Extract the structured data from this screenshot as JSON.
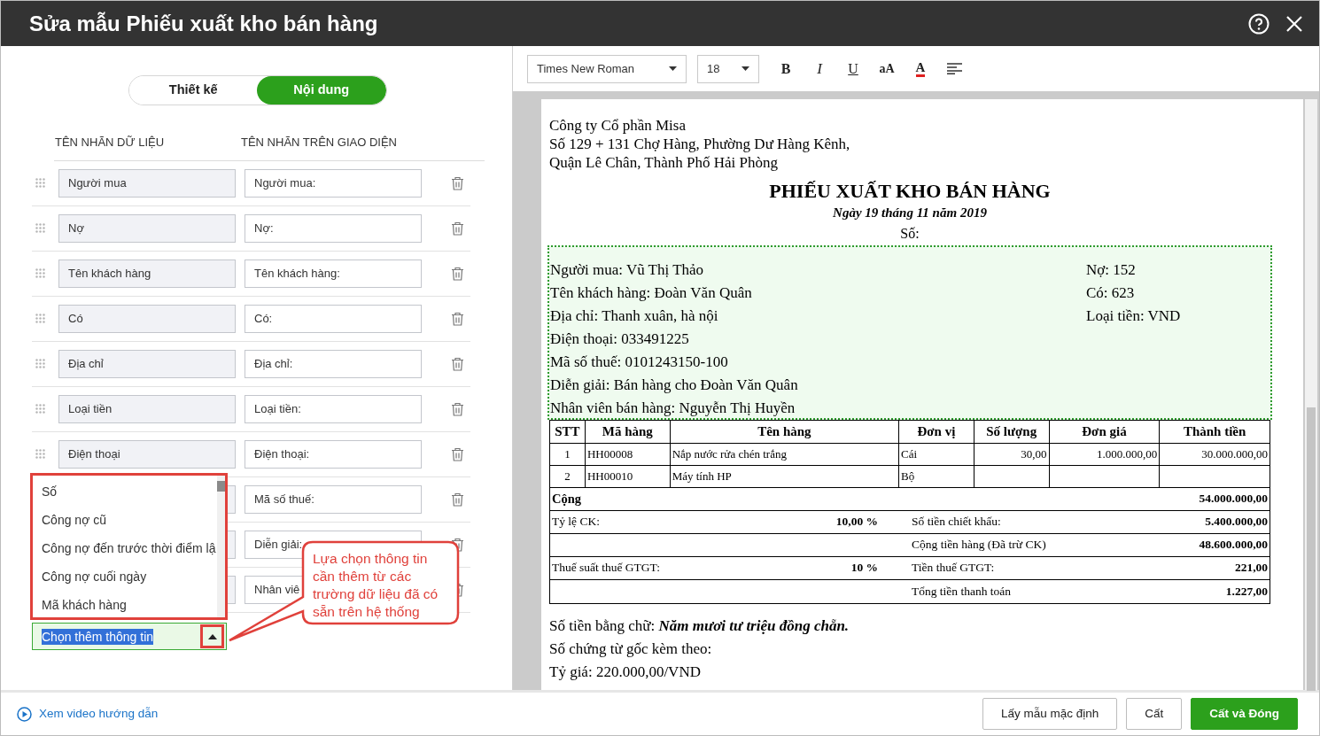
{
  "window": {
    "title": "Sửa mẫu Phiếu xuất kho bán hàng"
  },
  "tabs": [
    {
      "label": "Thiết kế",
      "selected": false
    },
    {
      "label": "Nội dung",
      "selected": true
    }
  ],
  "columns": [
    "TÊN NHÃN DỮ LIỆU",
    "TÊN NHÃN TRÊN GIAO DIỆN"
  ],
  "fields": [
    {
      "data_label": "Người mua",
      "display_label": "Người mua:"
    },
    {
      "data_label": "Nợ",
      "display_label": "Nợ:"
    },
    {
      "data_label": "Tên khách hàng",
      "display_label": "Tên khách hàng:"
    },
    {
      "data_label": "Có",
      "display_label": "Có:"
    },
    {
      "data_label": "Địa chỉ",
      "display_label": "Địa chỉ:"
    },
    {
      "data_label": "Loại tiền",
      "display_label": "Loại tiền:"
    },
    {
      "data_label": "Điện thoại",
      "display_label": "Điện thoại:"
    },
    {
      "display_label": "Mã số thuế:"
    },
    {
      "display_label": "Diễn giải:"
    },
    {
      "display_label": "Nhân viê"
    }
  ],
  "add_field": {
    "value": "Chọn thêm thông tin",
    "expanded": true,
    "options": [
      "Số",
      "Công nợ cũ",
      "Công nợ đến trước thời điểm lậ",
      "Công nợ cuối ngày",
      "Mã khách hàng"
    ]
  },
  "callout": {
    "lines": [
      "Lựa chọn thông tin",
      "cần thêm từ các",
      "trường dữ liệu đã có",
      "sẵn trên hệ thống"
    ]
  },
  "toolbar": {
    "font": "Times New Roman",
    "size": "18",
    "buttons": [
      {
        "kind": "bold",
        "label": "B"
      },
      {
        "kind": "italic",
        "label": "I"
      },
      {
        "kind": "underline",
        "label": "U"
      },
      {
        "kind": "case",
        "label": "aA"
      },
      {
        "kind": "color",
        "label": "A"
      },
      {
        "kind": "align"
      }
    ]
  },
  "document": {
    "company_lines": [
      "Công ty Cổ phần Misa",
      "Số 129 + 131 Chợ Hàng, Phường Dư Hàng Kênh,",
      "Quận Lê Chân, Thành Phố Hải Phòng"
    ],
    "title": "PHIẾU XUẤT KHO BÁN HÀNG",
    "date": "Ngày 19 tháng 11 năm 2019",
    "number_label": "Số:",
    "info_left": [
      "Người mua: Vũ Thị Thảo",
      "Tên khách hàng: Đoàn Văn Quân",
      "Địa chỉ: Thanh xuân, hà nội",
      "Điện thoại: 033491225",
      "Mã số thuế: 0101243150-100",
      "Diễn giải: Bán hàng cho Đoàn Văn Quân",
      "Nhân viên bán hàng: Nguyễn Thị Huyền"
    ],
    "info_right": [
      "Nợ: 152",
      "Có: 623",
      "Loại tiền: VND"
    ],
    "columns": [
      "STT",
      "Mã hàng",
      "Tên hàng",
      "Đơn vị",
      "Số lượng",
      "Đơn giá",
      "Thành tiền"
    ],
    "rows": [
      {
        "stt": "1",
        "code": "HH00008",
        "name": "Nắp nước rửa chén trắng",
        "unit": "Cái",
        "qty": "30,00",
        "price": "1.000.000,00",
        "amount": "30.000.000,00"
      },
      {
        "stt": "2",
        "code": "HH00010",
        "name": "Máy tính HP",
        "unit": "Bộ"
      }
    ],
    "summary": [
      {
        "kind": "total",
        "label": "Cộng",
        "value": "54.000.000,00"
      },
      {
        "kind": "pair",
        "left_label": "Tỷ lệ CK:",
        "left_value": "10,00 %",
        "right_label": "Số tiền chiết khấu:",
        "right_value": "5.400.000,00"
      },
      {
        "kind": "pair",
        "right_label": "Cộng tiền hàng (Đã trừ CK)",
        "right_value": "48.600.000,00"
      },
      {
        "kind": "pair",
        "left_label": "Thuế suất thuế GTGT:",
        "left_value": "10 %",
        "right_label": "Tiền thuế GTGT:",
        "right_value": "221,00"
      },
      {
        "kind": "pair",
        "right_label": "Tổng tiền thanh toán",
        "right_value": "1.227,00"
      }
    ],
    "footer_lines": [
      "Số tiền bằng chữ: **Năm mươi tư triệu đồng chẵn.**",
      "Số chứng từ gốc kèm theo:",
      "Tỷ giá: 220.000,00/VND"
    ]
  },
  "footer": {
    "link": "Xem video hướng dẫn",
    "buttons": [
      {
        "label": "Lấy mẫu mặc định",
        "kind": "secondary"
      },
      {
        "label": "Cất",
        "kind": "secondary"
      },
      {
        "label": "Cất và Đóng",
        "kind": "primary"
      }
    ]
  }
}
